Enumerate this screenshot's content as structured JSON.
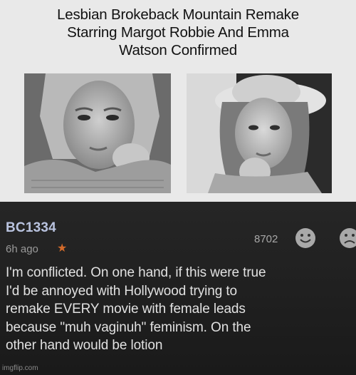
{
  "article": {
    "headline": "Lesbian Brokeback Mountain Remake\nStarring Margot Robbie And Emma\nWatson Confirmed"
  },
  "comment": {
    "username": "BC1334",
    "time_ago": "6h ago",
    "star_icon": "star-icon",
    "vote_count": "8702",
    "upvote_icon": "smile-icon",
    "downvote_icon": "frown-icon",
    "text": "I'm conflicted. On one hand, if this were true\nI'd be annoyed with Hollywood trying to\nremake EVERY movie with female leads\nbecause \"muh vaginuh\" feminism. On the\nother hand would be lotion"
  },
  "watermark": "imgflip.com",
  "colors": {
    "top_background": "#e9e9e9",
    "comment_background": "#1c1c1c",
    "username": "#b9c3df",
    "star": "#d36a2a",
    "comment_text": "#e1e1e1"
  }
}
